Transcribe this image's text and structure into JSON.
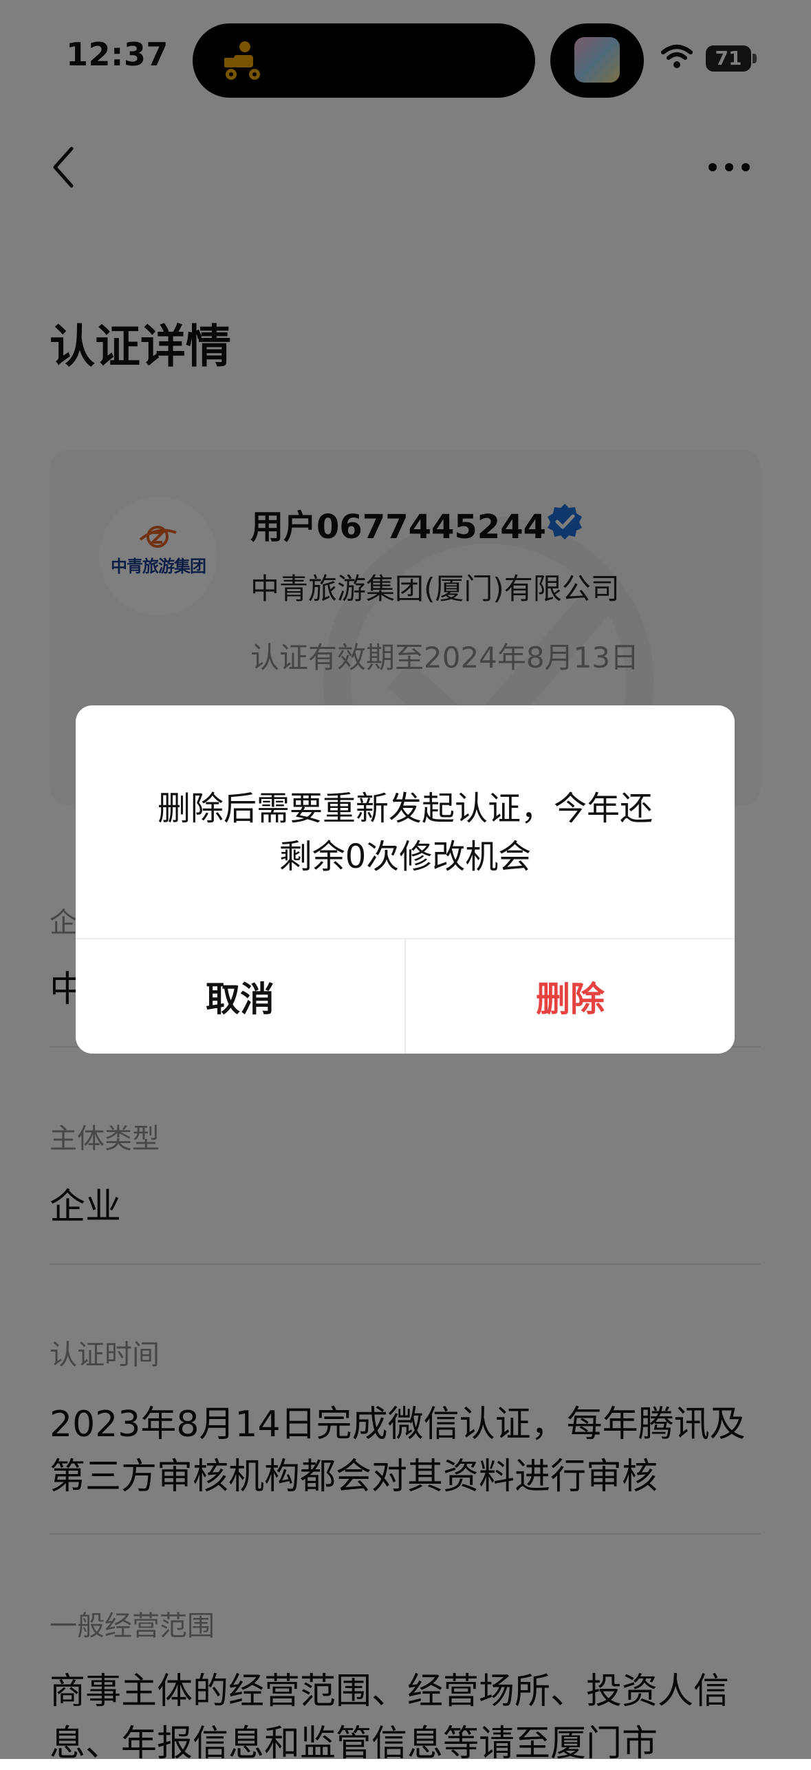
{
  "status_bar": {
    "time": "12:37",
    "battery": "71"
  },
  "nav": {
    "back_icon": "chevron-left-icon",
    "more_icon": "more-dots-icon"
  },
  "page": {
    "title": "认证详情"
  },
  "card": {
    "logo_text": "中青旅游集团",
    "user_name": "用户0677445244",
    "verified_color": "#1E6FD9",
    "company": "中青旅游集团(厦门)有限公司",
    "validity": "认证有效期至2024年8月13日"
  },
  "info": {
    "enterprise_label_partial": "企",
    "enterprise_value_partial": "中",
    "type_label": "主体类型",
    "type_value": "企业",
    "time_label": "认证时间",
    "time_value": "2023年8月14日完成微信认证，每年腾讯及第三方审核机构都会对其资料进行审核",
    "scope_label": "一般经营范围",
    "scope_value": "商事主体的经营范围、经营场所、投资人信息、年报信息和监管信息等请至厦门市"
  },
  "dialog": {
    "message_line1": "删除后需要重新发起认证，今年还",
    "message_line2": "剩余0次修改机会",
    "cancel_label": "取消",
    "delete_label": "删除",
    "delete_color": "#E64340"
  }
}
